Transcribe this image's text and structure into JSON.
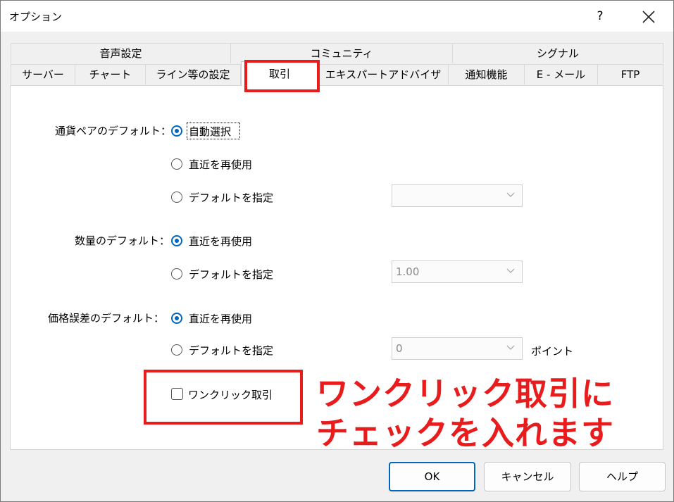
{
  "window": {
    "title": "オプション",
    "help_label": "?"
  },
  "tabs": {
    "row1": [
      "音声設定",
      "コミュニティ",
      "シグナル"
    ],
    "row2": [
      "サーバー",
      "チャート",
      "ライン等の設定",
      "取引",
      "エキスパートアドバイザ",
      "通知機能",
      "E - メール",
      "FTP"
    ],
    "active": "取引"
  },
  "trade": {
    "symbol_default": {
      "label": "通貨ペアのデフォルト：",
      "options": [
        "自動選択",
        "直近を再使用",
        "デフォルトを指定"
      ],
      "selected": "自動選択",
      "combo_value": ""
    },
    "volume_default": {
      "label": "数量のデフォルト：",
      "options": [
        "直近を再使用",
        "デフォルトを指定"
      ],
      "selected": "直近を再使用",
      "combo_value": "1.00"
    },
    "slippage_default": {
      "label": "価格誤差のデフォルト：",
      "options": [
        "直近を再使用",
        "デフォルトを指定"
      ],
      "selected": "直近を再使用",
      "combo_value": "0",
      "unit": "ポイント"
    },
    "one_click": {
      "label": "ワンクリック取引",
      "checked": false
    }
  },
  "annotation": {
    "line1": "ワンクリック取引に",
    "line2": "チェックを入れます",
    "color": "#e81c1c"
  },
  "buttons": {
    "ok": "OK",
    "cancel": "キャンセル",
    "help": "ヘルプ"
  }
}
